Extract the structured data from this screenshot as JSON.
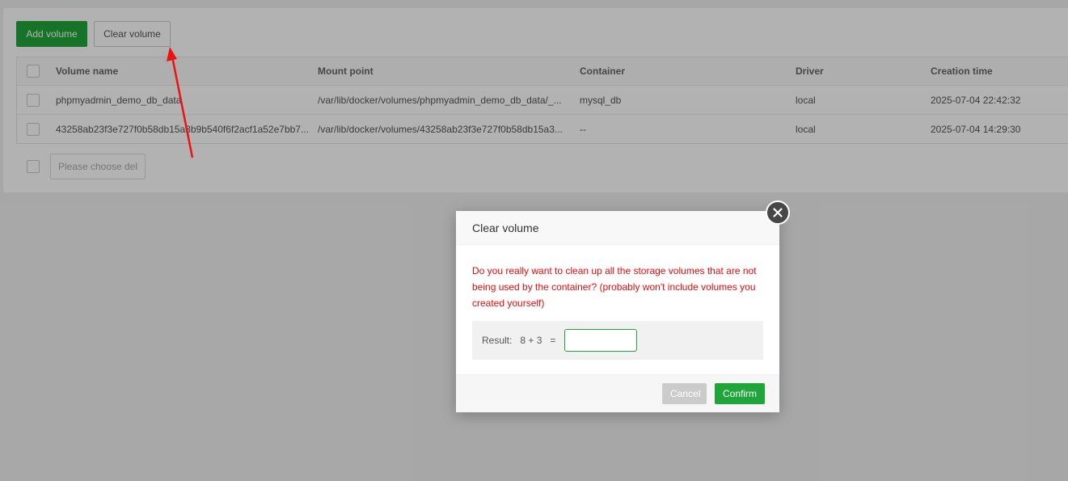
{
  "toolbar": {
    "add_label": "Add volume",
    "clear_label": "Clear volume"
  },
  "table": {
    "headers": {
      "name": "Volume name",
      "mount": "Mount point",
      "container": "Container",
      "driver": "Driver",
      "time": "Creation time"
    },
    "rows": [
      {
        "name": "phpmyadmin_demo_db_data",
        "mount": "/var/lib/docker/volumes/phpmyadmin_demo_db_data/_...",
        "container": "mysql_db",
        "driver": "local",
        "time": "2025-07-04 22:42:32"
      },
      {
        "name": "43258ab23f3e727f0b58db15a3b9b540f6f2acf1a52e7bb7...",
        "mount": "/var/lib/docker/volumes/43258ab23f3e727f0b58db15a3...",
        "container": "--",
        "driver": "local",
        "time": "2025-07-04 14:29:30"
      }
    ]
  },
  "bulk": {
    "del_label": "Please choose del"
  },
  "modal": {
    "title": "Clear volume",
    "warning": "Do you really want to clean up all the storage volumes that are not being used by the container? (probably won't include volumes you created yourself)",
    "verify_label": "Result:",
    "verify_expr": "8 + 3",
    "verify_eq": "=",
    "input_value": "",
    "cancel_label": "Cancel",
    "confirm_label": "Confirm"
  },
  "colors": {
    "primary": "#20a53a",
    "warning": "#ef0808",
    "arrow": "#ee1111"
  },
  "icons": {
    "close": "close-icon",
    "annotation": "arrow-annotation"
  }
}
